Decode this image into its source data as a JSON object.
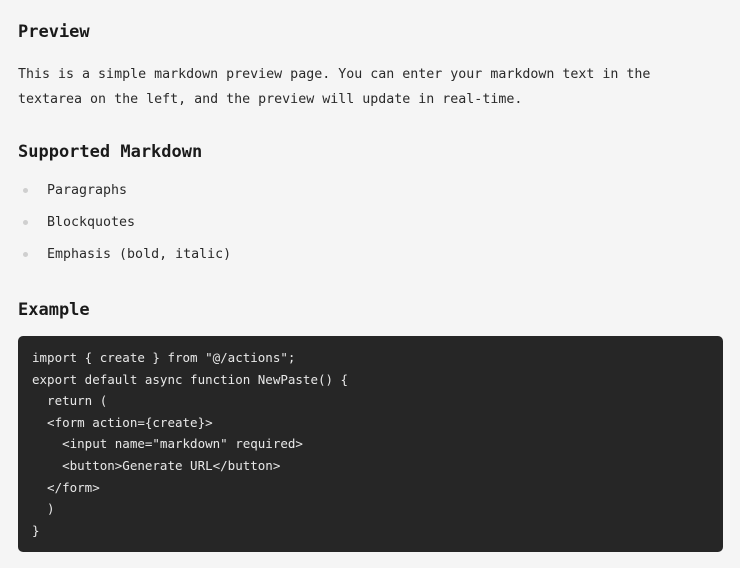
{
  "preview": {
    "heading": "Preview",
    "intro_line_1": "This is a simple markdown preview page. You can enter your markdown text in the",
    "intro_line_2": "textarea on the left, and the preview will update in real-time."
  },
  "supported": {
    "heading": "Supported Markdown",
    "items": [
      {
        "label": "Paragraphs"
      },
      {
        "label": "Blockquotes"
      },
      {
        "label": "Emphasis (bold, italic)"
      }
    ]
  },
  "example": {
    "heading": "Example",
    "code_lines": [
      "import { create } from \"@/actions\";",
      "export default async function NewPaste() {",
      "  return (",
      "  <form action={create}>",
      "    <input name=\"markdown\" required>",
      "    <button>Generate URL</button>",
      "  </form>",
      "  )",
      "}"
    ]
  },
  "colors": {
    "page_background": "#f5f5f5",
    "code_background": "#262626",
    "code_text": "#e8e8e8",
    "bullet": "#cfcfcf"
  }
}
